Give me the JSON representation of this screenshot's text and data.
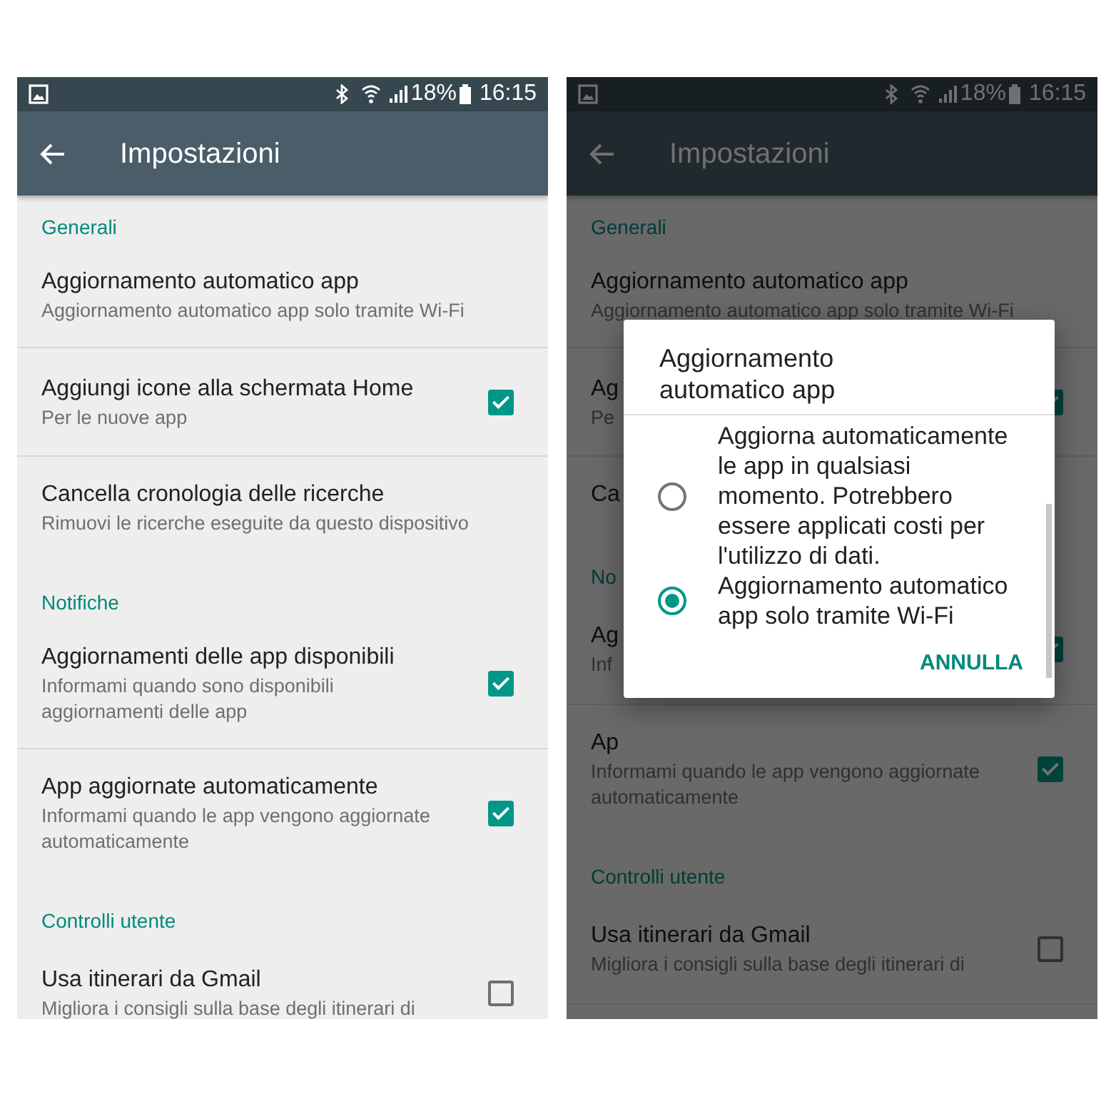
{
  "screens": [
    {
      "dimmed": false,
      "status_bar": {
        "battery": "18%",
        "time": "16:15"
      },
      "app_bar": {
        "title": "Impostazioni"
      },
      "items": [
        {
          "kind": "header",
          "text": "Generali"
        },
        {
          "kind": "setting",
          "title": "Aggiornamento automatico app",
          "subtitle": "Aggiornamento automatico app solo tramite Wi-Fi"
        },
        {
          "kind": "setting",
          "title": "Aggiungi icone alla schermata Home",
          "subtitle": "Per le nuove app",
          "checked": true
        },
        {
          "kind": "setting",
          "title": "Cancella cronologia delle ricerche",
          "subtitle": "Rimuovi le ricerche eseguite da questo dispositivo"
        },
        {
          "kind": "header",
          "text": "Notifiche"
        },
        {
          "kind": "setting",
          "title": "Aggiornamenti delle app disponibili",
          "subtitle": "Informami quando sono disponibili aggiornamenti delle app",
          "checked": true
        },
        {
          "kind": "setting",
          "title": "App aggiornate automaticamente",
          "subtitle": "Informami quando le app vengono aggiornate automaticamente",
          "checked": true
        },
        {
          "kind": "header",
          "text": "Controlli utente"
        },
        {
          "kind": "setting",
          "title": "Usa itinerari da Gmail",
          "subtitle": "Migliora i consigli sulla base degli itinerari di",
          "checked": false
        }
      ]
    },
    {
      "dimmed": true,
      "status_bar": {
        "battery": "18%",
        "time": "16:15"
      },
      "app_bar": {
        "title": "Impostazioni"
      },
      "items": [
        {
          "kind": "header",
          "text": "Generali"
        },
        {
          "kind": "setting",
          "title": "Aggiornamento automatico app",
          "subtitle": "Aggiornamento automatico app solo tramite Wi-Fi"
        },
        {
          "kind": "setting",
          "title": "Ag",
          "subtitle": "Pe",
          "checked": true
        },
        {
          "kind": "setting",
          "title": "Ca"
        },
        {
          "kind": "header",
          "text": "No"
        },
        {
          "kind": "setting",
          "title": "Ag",
          "subtitle": "Inf",
          "checked": true
        },
        {
          "kind": "setting",
          "title": "Ap",
          "subtitle": "Informami quando le app vengono aggiornate automaticamente",
          "checked": true
        },
        {
          "kind": "header",
          "text": "Controlli utente"
        },
        {
          "kind": "setting",
          "title": "Usa itinerari da Gmail",
          "subtitle": "Migliora i consigli sulla base degli itinerari di",
          "checked": false
        }
      ],
      "dialog": {
        "title": "Aggiornamento automatico app",
        "options": [
          {
            "label": "Aggiorna automaticamente le app in qualsiasi momento. Potrebbero essere applicati costi per l'utilizzo di dati.",
            "selected": false
          },
          {
            "label": "Aggiornamento automatico app solo tramite Wi-Fi",
            "selected": true
          }
        ],
        "button": "ANNULLA"
      }
    }
  ]
}
